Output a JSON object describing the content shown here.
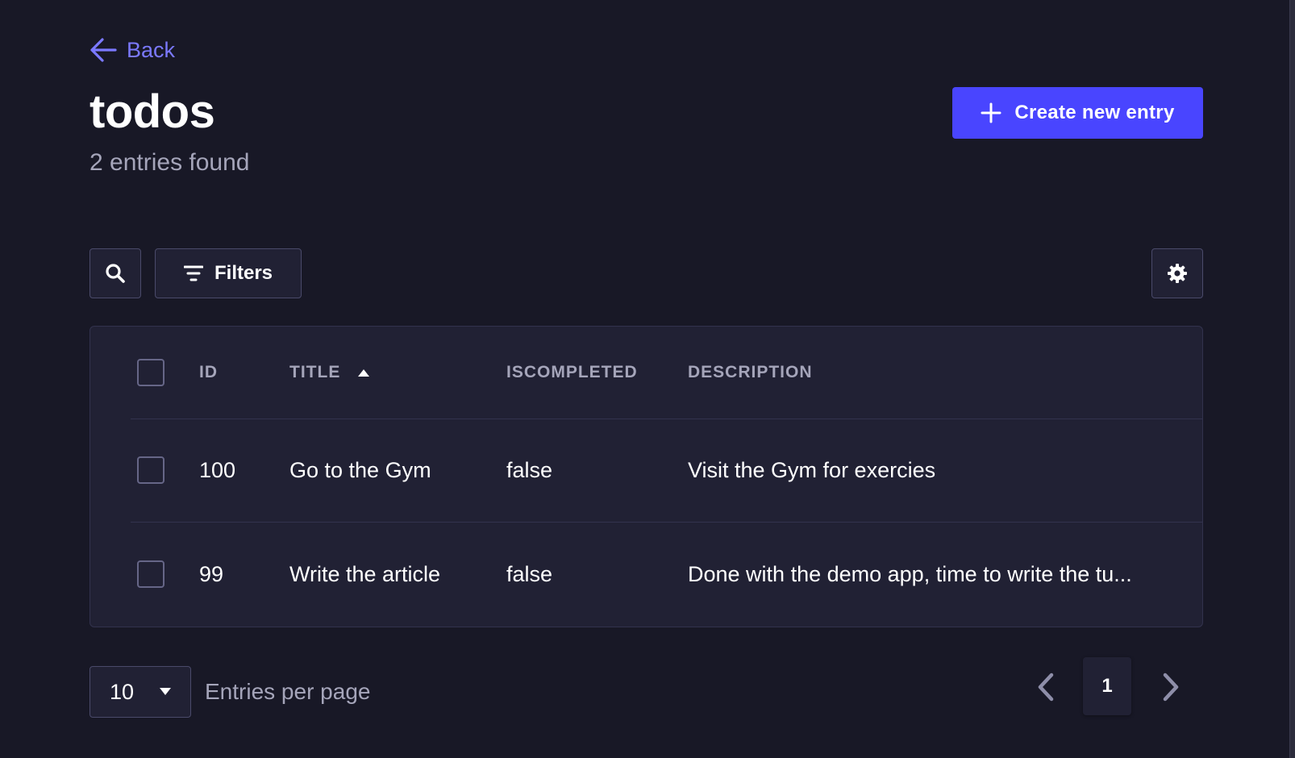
{
  "header": {
    "back_label": "Back",
    "title": "todos",
    "subtitle": "2 entries found",
    "create_button_label": "Create new entry"
  },
  "toolbar": {
    "filters_label": "Filters"
  },
  "table": {
    "columns": {
      "id": "ID",
      "title": "TITLE",
      "iscompleted": "ISCOMPLETED",
      "description": "DESCRIPTION"
    },
    "sort": {
      "column": "TITLE",
      "direction": "ascending"
    },
    "rows": [
      {
        "id": "100",
        "title": "Go to the Gym",
        "iscompleted": "false",
        "description": "Visit the Gym for exercies"
      },
      {
        "id": "99",
        "title": "Write the article",
        "iscompleted": "false",
        "description": "Done with the demo app, time to write the tu..."
      }
    ]
  },
  "footer": {
    "per_page_value": "10",
    "per_page_label": "Entries per page",
    "current_page": "1"
  },
  "colors": {
    "background": "#181826",
    "surface": "#212134",
    "accent": "#4945ff",
    "link": "#7b79ff",
    "muted_text": "#a5a5ba",
    "border": "#32324d"
  },
  "icons": {
    "back": "arrow-left-icon",
    "create": "plus-icon",
    "search": "search-icon",
    "filters": "filter-icon",
    "settings": "gear-icon",
    "sort": "caret-up-icon",
    "select": "caret-down-icon",
    "prev": "chevron-left-icon",
    "next": "chevron-right-icon"
  }
}
